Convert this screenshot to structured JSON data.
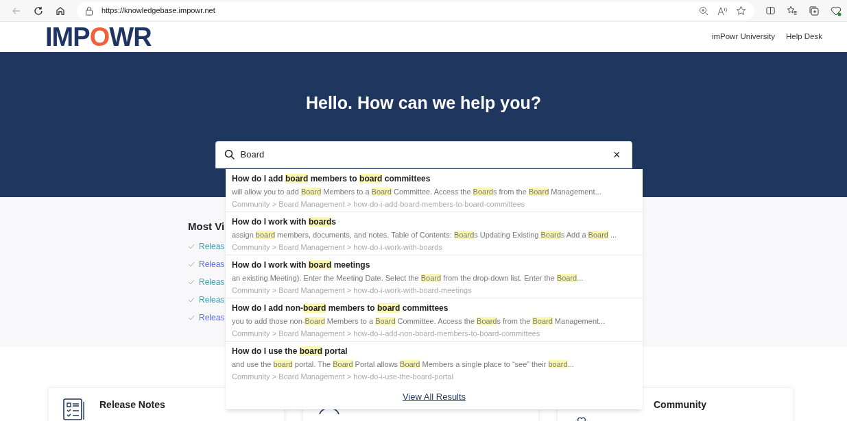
{
  "browser": {
    "url": "https://knowledgebase.impowr.net"
  },
  "header": {
    "logo": "IMPOWR",
    "nav": [
      "imPowr University",
      "Help Desk"
    ]
  },
  "hero": {
    "title": "Hello. How can we help you?"
  },
  "search": {
    "value": "Board",
    "clear": "×"
  },
  "results": [
    {
      "title": [
        {
          "text": "How do I add ",
          "highlighted": false
        },
        {
          "text": "board",
          "highlighted": true
        },
        {
          "text": " members to ",
          "highlighted": false
        },
        {
          "text": "board",
          "highlighted": true
        },
        {
          "text": " committees",
          "highlighted": false
        }
      ],
      "snippet": [
        {
          "text": "will allow you to add ",
          "highlighted": false
        },
        {
          "text": "Board",
          "highlighted": true
        },
        {
          "text": " Members to a ",
          "highlighted": false
        },
        {
          "text": "Board",
          "highlighted": true
        },
        {
          "text": " Committee. Access the ",
          "highlighted": false
        },
        {
          "text": "Board",
          "highlighted": true
        },
        {
          "text": "s from the ",
          "highlighted": false
        },
        {
          "text": "Board",
          "highlighted": true
        },
        {
          "text": " Management...",
          "highlighted": false
        }
      ],
      "path": "Community > Board Management > how-do-i-add-board-members-to-board-committees"
    },
    {
      "title": [
        {
          "text": "How do I work with ",
          "highlighted": false
        },
        {
          "text": "board",
          "highlighted": true
        },
        {
          "text": "s",
          "highlighted": false
        }
      ],
      "snippet": [
        {
          "text": "assign ",
          "highlighted": false
        },
        {
          "text": "board",
          "highlighted": true
        },
        {
          "text": " members, documents, and notes. Table of Contents: ",
          "highlighted": false
        },
        {
          "text": "Board",
          "highlighted": true
        },
        {
          "text": "s Updating Existing ",
          "highlighted": false
        },
        {
          "text": "Board",
          "highlighted": true
        },
        {
          "text": "s Add a ",
          "highlighted": false
        },
        {
          "text": "Board",
          "highlighted": true
        },
        {
          "text": " ...",
          "highlighted": false
        }
      ],
      "path": "Community > Board Management > how-do-i-work-with-boards"
    },
    {
      "title": [
        {
          "text": "How do I work with ",
          "highlighted": false
        },
        {
          "text": "board",
          "highlighted": true
        },
        {
          "text": " meetings",
          "highlighted": false
        }
      ],
      "snippet": [
        {
          "text": "an existing Meeting). Enter the Meeting Date. Select the ",
          "highlighted": false
        },
        {
          "text": "Board",
          "highlighted": true
        },
        {
          "text": " from the drop-down list. Enter the ",
          "highlighted": false
        },
        {
          "text": "Board",
          "highlighted": true
        },
        {
          "text": "...",
          "highlighted": false
        }
      ],
      "path": "Community > Board Management > how-do-i-work-with-board-meetings"
    },
    {
      "title": [
        {
          "text": "How do I add non-",
          "highlighted": false
        },
        {
          "text": "board",
          "highlighted": true
        },
        {
          "text": " members to ",
          "highlighted": false
        },
        {
          "text": "board",
          "highlighted": true
        },
        {
          "text": " committees",
          "highlighted": false
        }
      ],
      "snippet": [
        {
          "text": "you to add those non-",
          "highlighted": false
        },
        {
          "text": "Board",
          "highlighted": true
        },
        {
          "text": " Members to a ",
          "highlighted": false
        },
        {
          "text": "Board",
          "highlighted": true
        },
        {
          "text": " Committee. Access the ",
          "highlighted": false
        },
        {
          "text": "Board",
          "highlighted": true
        },
        {
          "text": "s from the ",
          "highlighted": false
        },
        {
          "text": "Board",
          "highlighted": true
        },
        {
          "text": " Management...",
          "highlighted": false
        }
      ],
      "path": "Community > Board Management > how-do-i-add-non-board-members-to-board-committees"
    },
    {
      "title": [
        {
          "text": "How do I use the ",
          "highlighted": false
        },
        {
          "text": "board",
          "highlighted": true
        },
        {
          "text": " portal",
          "highlighted": false
        }
      ],
      "snippet": [
        {
          "text": "and use the ",
          "highlighted": false
        },
        {
          "text": "board",
          "highlighted": true
        },
        {
          "text": " portal. The ",
          "highlighted": false
        },
        {
          "text": "Board",
          "highlighted": true
        },
        {
          "text": " Portal allows ",
          "highlighted": false
        },
        {
          "text": "Board",
          "highlighted": true
        },
        {
          "text": " Members a single place to “see” their ",
          "highlighted": false
        },
        {
          "text": "board",
          "highlighted": true
        },
        {
          "text": "...",
          "highlighted": false
        }
      ],
      "path": "Community > Board Management > how-do-i-use-the-board-portal"
    }
  ],
  "view_all": "View All Results",
  "most_viewed": {
    "title": "Most Vi",
    "links": [
      {
        "label": "Releas",
        "color": "#3a9fb5"
      },
      {
        "label": "Releas",
        "color": "#5b6ee8"
      },
      {
        "label": "Releas",
        "color": "#3a9fb5"
      },
      {
        "label": "Releas",
        "color": "#3a9fb5"
      },
      {
        "label": "Releas",
        "color": "#5b6ee8"
      }
    ]
  },
  "cards": [
    {
      "kind": "notes",
      "title": "Release Notes"
    },
    {
      "kind": "support"
    },
    {
      "kind": "community",
      "title": "Community"
    }
  ]
}
